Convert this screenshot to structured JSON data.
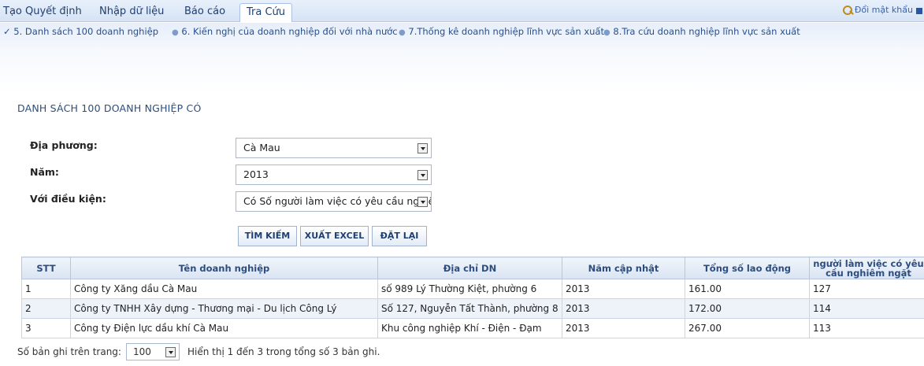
{
  "nav": {
    "tabs": [
      {
        "label": "Tạo Quyết định"
      },
      {
        "label": "Nhập dữ liệu"
      },
      {
        "label": "Báo cáo"
      },
      {
        "label": "Tra Cứu"
      }
    ],
    "active_tab": "Tra Cứu",
    "change_password": "Đổi mật khẩu"
  },
  "subnav": {
    "items": [
      {
        "label": "5. Danh sách 100 doanh nghiệp",
        "active": true
      },
      {
        "label": "6. Kiến nghị của doanh nghiệp đối với nhà nước"
      },
      {
        "label": "7.Thống kê doanh nghiệp lĩnh vực sản xuất"
      },
      {
        "label": "8.Tra cứu doanh nghiệp lĩnh vực sản xuất"
      }
    ]
  },
  "page": {
    "title": "DANH SÁCH 100 DOANH NGHIỆP CÓ"
  },
  "filters": {
    "locality_label": "Địa phương:",
    "locality_value": "Cà Mau",
    "year_label": "Năm:",
    "year_value": "2013",
    "condition_label": "Với điều kiện:",
    "condition_value": "Có Số người làm việc có yêu cầu nghiêm ngặt"
  },
  "buttons": {
    "search": "TÌM KIẾM",
    "export": "XUẤT EXCEL",
    "reset": "ĐẶT LẠI"
  },
  "table": {
    "columns": [
      "STT",
      "Tên doanh nghiệp",
      "Địa chỉ DN",
      "Năm cập nhật",
      "Tổng số lao động",
      "người làm việc có yêu cầu nghiêm ngặt"
    ],
    "rows": [
      [
        "1",
        "Công ty Xăng dầu Cà Mau",
        "số 989 Lý Thường Kiệt, phường 6",
        "2013",
        "161.00",
        "127"
      ],
      [
        "2",
        "Công ty TNHH Xây dựng - Thương mại - Du lịch Công Lý",
        "Số 127, Nguyễn Tất Thành, phường 8",
        "2013",
        "172.00",
        "114"
      ],
      [
        "3",
        "Công ty Điện lực dầu khí Cà Mau",
        "Khu công nghiệp Khí - Điện - Đạm",
        "2013",
        "267.00",
        "113"
      ]
    ]
  },
  "footer": {
    "per_page_label": "Số bản ghi trên trang:",
    "per_page_value": "100",
    "summary": "Hiển thị 1 đến 3 trong tổng số 3 bản ghi."
  },
  "colors": {
    "accent": "#2c4d7e",
    "header_bg": "#d9e4f3",
    "alt_row": "#eef3fa"
  }
}
